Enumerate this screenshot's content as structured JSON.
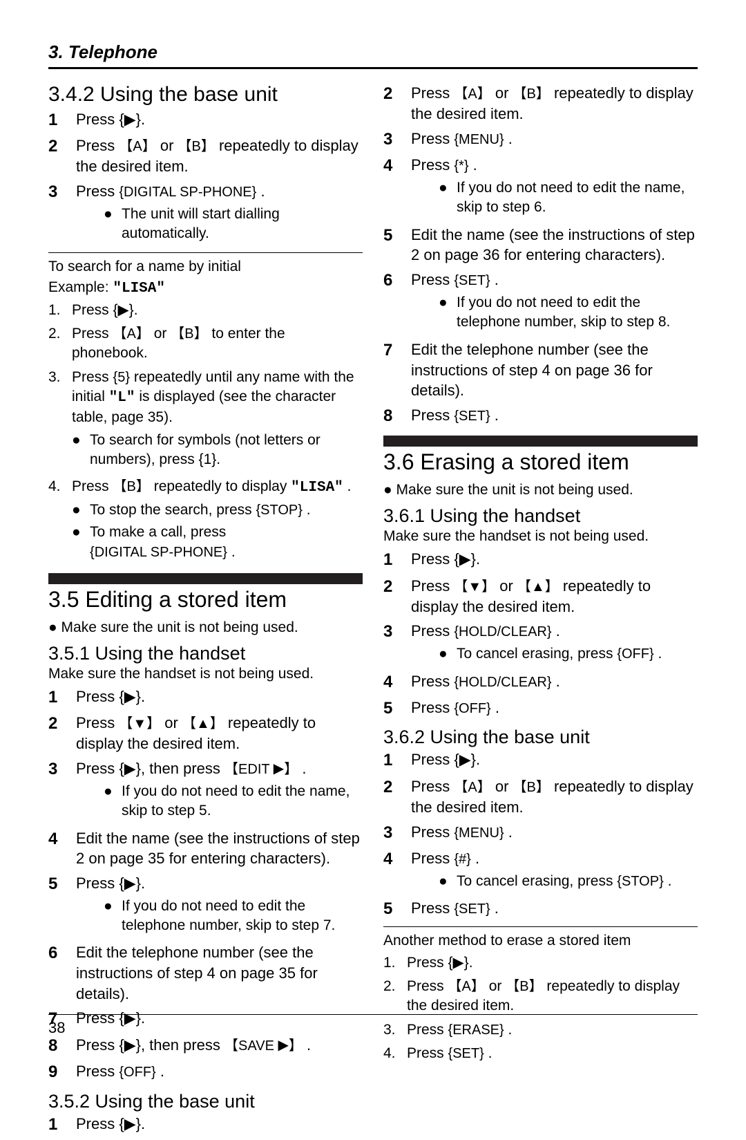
{
  "header": "3. Telephone",
  "page_number": "38",
  "left": {
    "sec_342_title": "3.4.2 Using the base unit",
    "s342_1": "Press {▶}.",
    "s342_2_a": "Press ",
    "s342_2_b": " or ",
    "s342_2_c": " repeatedly to display the desired item.",
    "s342_3_a": "Press ",
    "s342_3_b": ".",
    "s342_3_bullet": "The unit will start dialling automatically.",
    "search_heading": "To search for a name by initial",
    "search_example_label": "Example: ",
    "search_example_value": "\"LISA\"",
    "ss1": "Press {▶}.",
    "ss2_a": "Press ",
    "ss2_b": " or ",
    "ss2_c": " to enter the phonebook.",
    "ss3_a": "Press ",
    "ss3_b": " repeatedly until any name with the initial ",
    "ss3_c": " is displayed (see the character table, page 35).",
    "ss3_bullet": "To search for symbols (not letters or numbers), press {1}.",
    "ss4_a": "Press ",
    "ss4_b": " repeatedly to display ",
    "ss4_c": ".",
    "ss4_bullet1_a": "To stop the search, press ",
    "ss4_bullet1_b": ".",
    "ss4_bullet2_a": "To make a call, press ",
    "ss4_bullet2_b": ".",
    "h2_35": "3.5 Editing a stored item",
    "note35": "Make sure the unit is not being used.",
    "sec_351_title": "3.5.1 Using the handset",
    "s351_small": "Make sure the handset is not being used.",
    "s351_1": "Press {▶}.",
    "s351_2_a": "Press ",
    "s351_2_b": " or ",
    "s351_2_c": " repeatedly to display the desired item.",
    "s351_3_a": "Press {▶}, then press ",
    "s351_3_b": ".",
    "s351_3_bullet": "If you do not need to edit the name, skip to step 5.",
    "s351_4_a": "Edit the name (see the instructions of step 2 on page 35 for entering characters).",
    "s351_5": "Press {▶}.",
    "s351_5_bullet": "If you do not need to edit the telephone number, skip to step 7.",
    "s351_6": "Edit the telephone number (see the instructions of step 4 on page 35 for details).",
    "s351_7": "Press {▶}.",
    "s351_8_a": "Press {▶}, then press ",
    "s351_8_b": ".",
    "s351_9_a": "Press ",
    "s351_9_b": ".",
    "sec_352_title": "3.5.2 Using the base unit",
    "s352_1": "Press {▶}.",
    "btn_A": "A",
    "btn_B": "B",
    "btn_dsp": "DIGITAL SP-PHONE",
    "btn_5": "5",
    "str_L": "\"L\"",
    "str_LISA": "\"LISA\"",
    "btn_STOP": "STOP",
    "btn_v": "▼",
    "btn_e": "▲",
    "btn_EDIT": "EDIT",
    "btn_SAVE": "SAVE",
    "btn_OFF": "OFF"
  },
  "right": {
    "r2_a": "Press ",
    "r2_b": " or ",
    "r2_c": " repeatedly to display the desired item.",
    "r3_a": "Press ",
    "r3_b": ".",
    "r4_a": "Press ",
    "r4_b": ".",
    "r4_bullet": "If you do not need to edit the name, skip to step 6.",
    "r5": "Edit the name (see the instructions of step 2 on page 36 for entering characters).",
    "r6_a": "Press ",
    "r6_b": ".",
    "r6_bullet": "If you do not need to edit the telephone number, skip to step 8.",
    "r7": "Edit the telephone number (see the instructions of step 4 on page 36 for details).",
    "r8_a": "Press ",
    "r8_b": ".",
    "h2_36": "3.6 Erasing a stored item",
    "note36": "Make sure the unit is not being used.",
    "sec_361_title": "3.6.1 Using the handset",
    "s361_small": "Make sure the handset is not being used.",
    "s361_1": "Press {▶}.",
    "s361_2_a": "Press ",
    "s361_2_b": " or ",
    "s361_2_c": " repeatedly to display the desired item.",
    "s361_3_a": "Press ",
    "s361_3_b": ".",
    "s361_3_bullet_a": "To cancel erasing, press ",
    "s361_3_bullet_b": ".",
    "s361_4_a": "Press ",
    "s361_4_b": ".",
    "s361_5_a": "Press ",
    "s361_5_b": ".",
    "sec_362_title": "3.6.2 Using the base unit",
    "s362_1_a": "Press ",
    "s362_1_b": ".",
    "s362_2_a": "Press ",
    "s362_2_b": " or ",
    "s362_2_c": " repeatedly to display the desired item.",
    "s362_3_a": "Press ",
    "s362_3_b": ".",
    "s362_4_a": "Press ",
    "s362_4_b": ".",
    "s362_4_bullet_a": "To cancel erasing, press ",
    "s362_4_bullet_b": ".",
    "s362_5_a": "Press ",
    "s362_5_b": ".",
    "another_title": "Another method to erase a stored item",
    "a1": "Press {▶}.",
    "a2_a": "Press ",
    "a2_b": " or ",
    "a2_c": " repeatedly to display the desired item.",
    "a3_a": "Press ",
    "a3_b": ".",
    "a4_a": "Press ",
    "a4_b": ".",
    "btn_A": "A",
    "btn_B": "B",
    "btn_MENU": "MENU",
    "btn_star": "*",
    "btn_SET": "SET",
    "btn_v": "▼",
    "btn_e": "▲",
    "btn_HOLDCLEAR": "HOLD/CLEAR",
    "btn_OFF": "OFF",
    "btn_hash": "#",
    "btn_STOP": "STOP",
    "btn_ERASE": "ERASE"
  }
}
